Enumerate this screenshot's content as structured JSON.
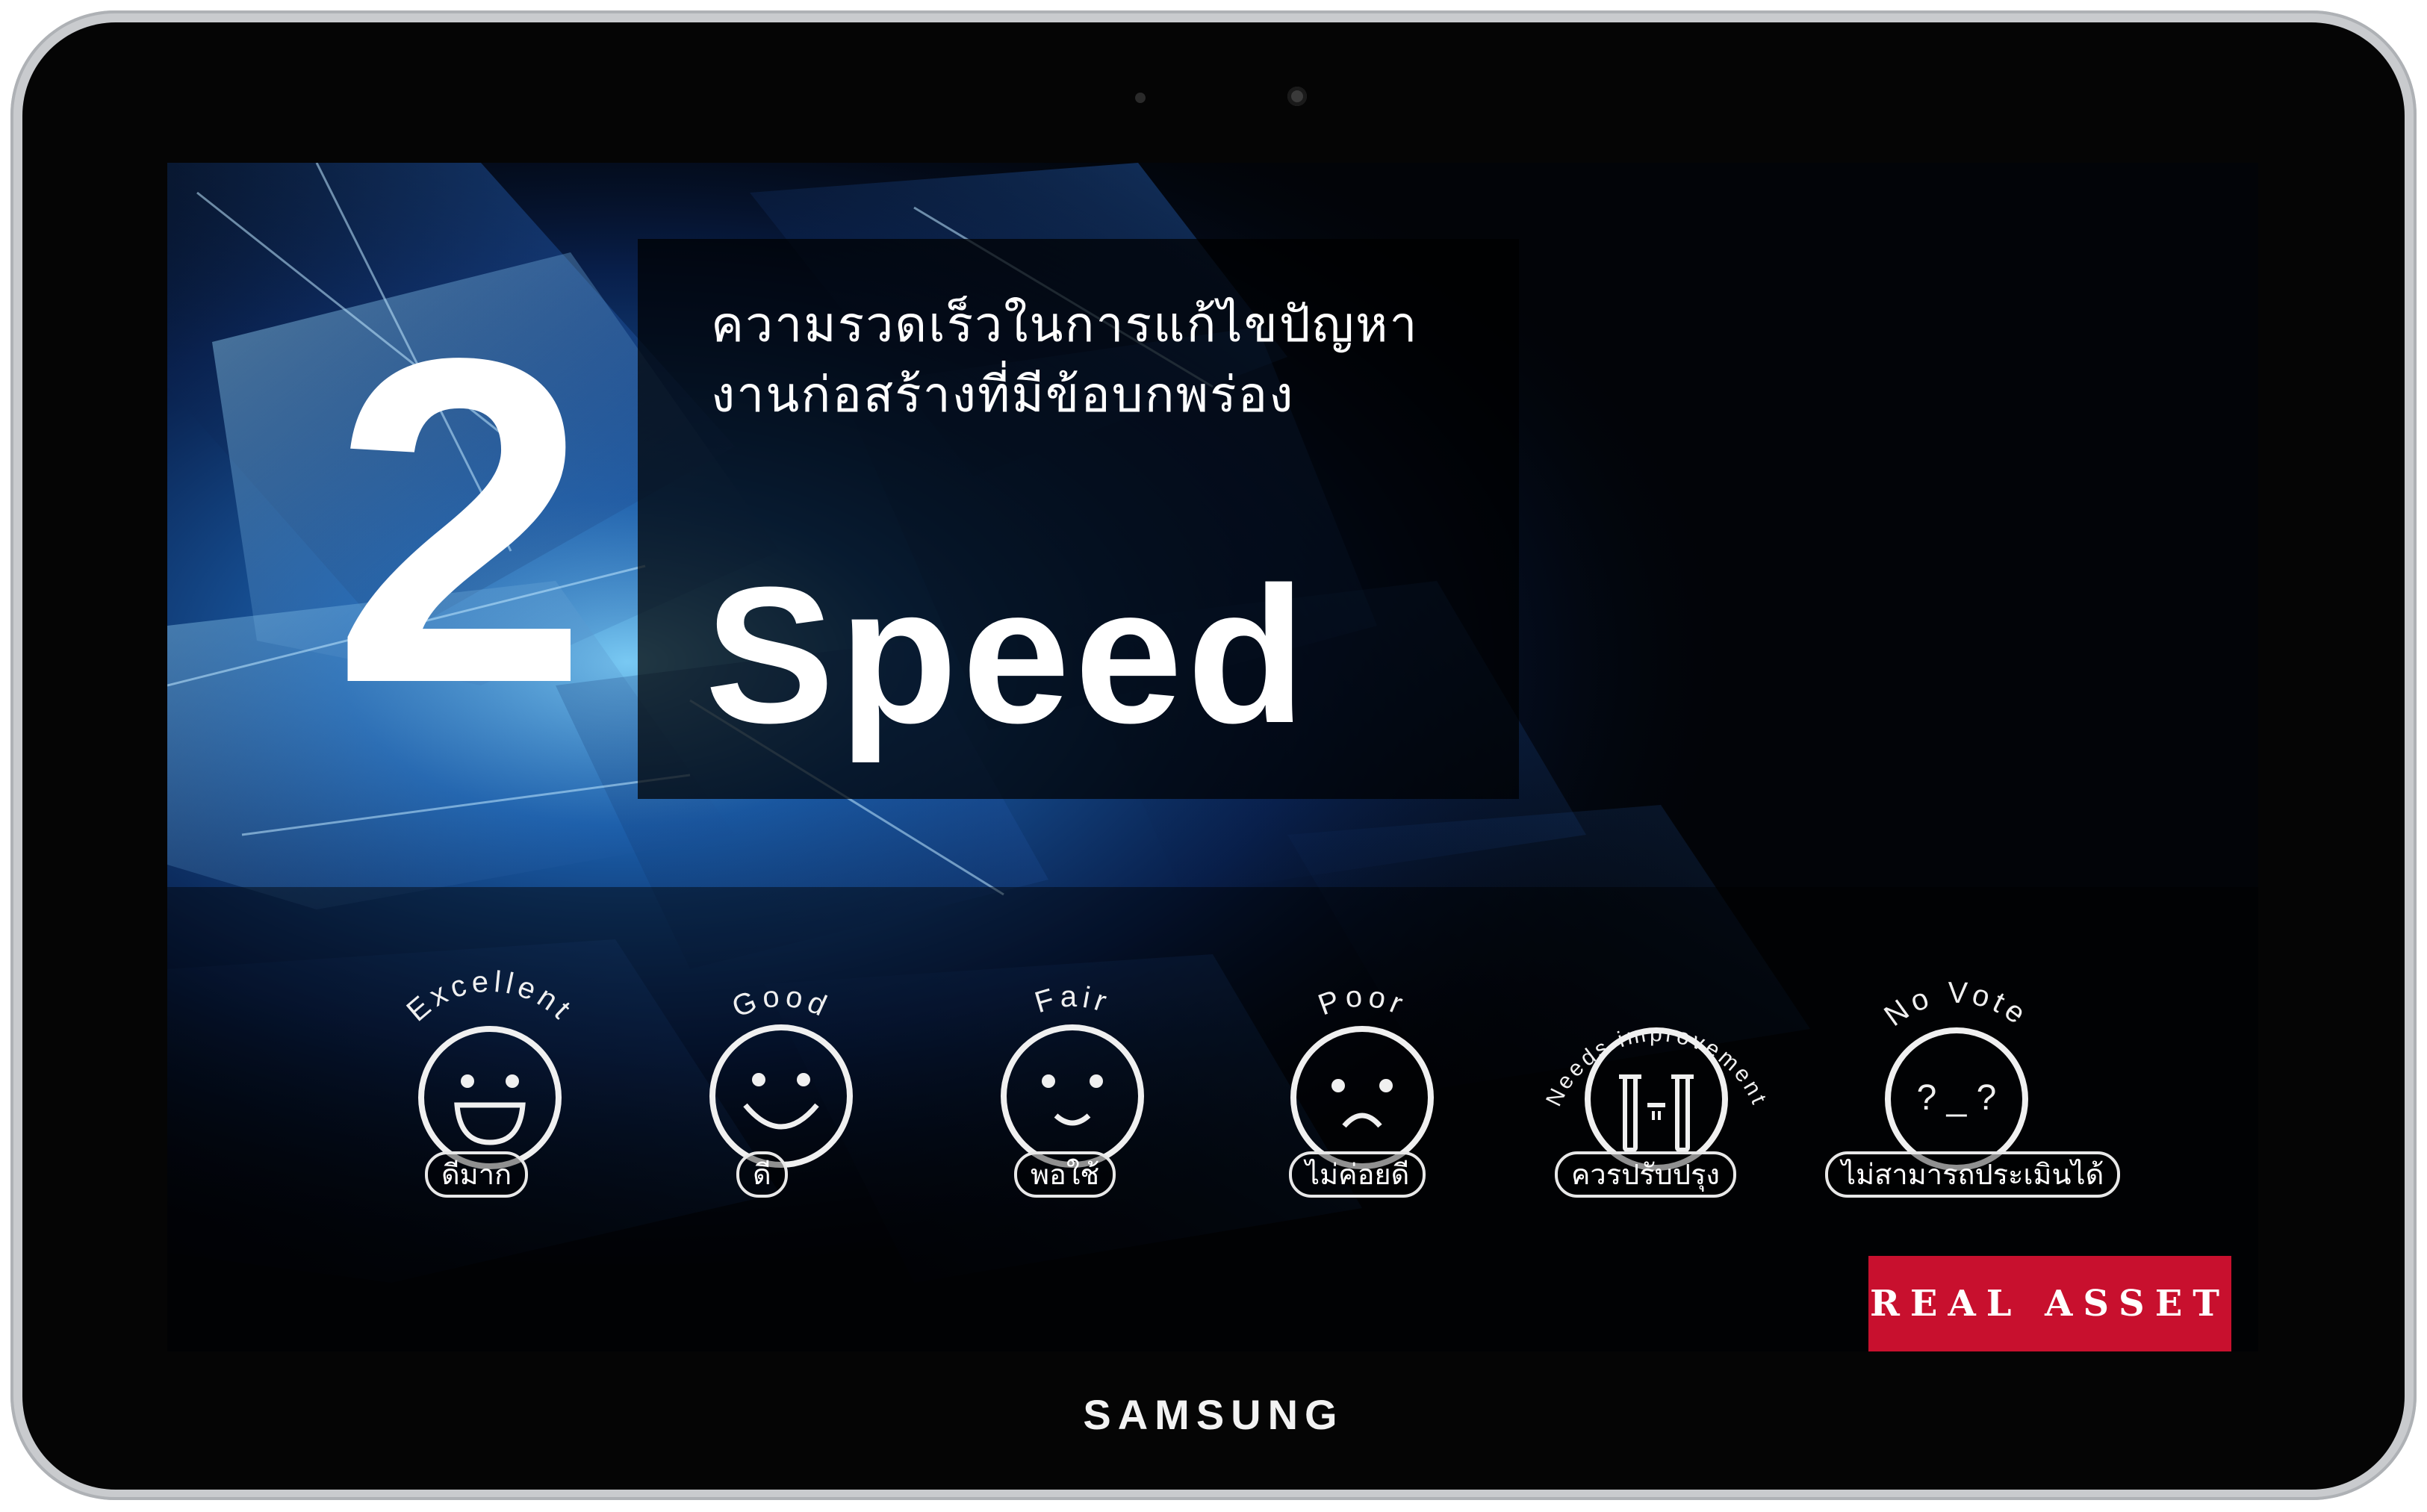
{
  "device": {
    "brand": "SAMSUNG"
  },
  "screen": {
    "number": "2",
    "title_line1": "ความรวดเร็วในการแก้ไขปัญหา",
    "title_line2": "งานก่อสร้างที่มีข้อบกพร่อง",
    "heading": "Speed",
    "accent_color": "#2f7fd6",
    "logo_text": "REAL ASSET",
    "logo_color": "#c8102e"
  },
  "votes": [
    {
      "id": "excellent",
      "arc_label": "Excellent",
      "label": "ดีมาก",
      "icon": "big-smile-face-icon"
    },
    {
      "id": "good",
      "arc_label": "Good",
      "label": "ดี",
      "icon": "smile-face-icon"
    },
    {
      "id": "fair",
      "arc_label": "Fair",
      "label": "พอใช้",
      "icon": "slight-smile-face-icon"
    },
    {
      "id": "poor",
      "arc_label": "Poor",
      "label": "ไม่ค่อยดี",
      "icon": "frown-face-icon"
    },
    {
      "id": "needs-improvement",
      "arc_label": "Needs improvement",
      "label": "ควรปรับปรุง",
      "icon": "crying-face-icon"
    },
    {
      "id": "no-vote",
      "arc_label": "No Vote",
      "label": "ไม่สามารถประเมินได้",
      "icon": "question-face-icon"
    }
  ]
}
